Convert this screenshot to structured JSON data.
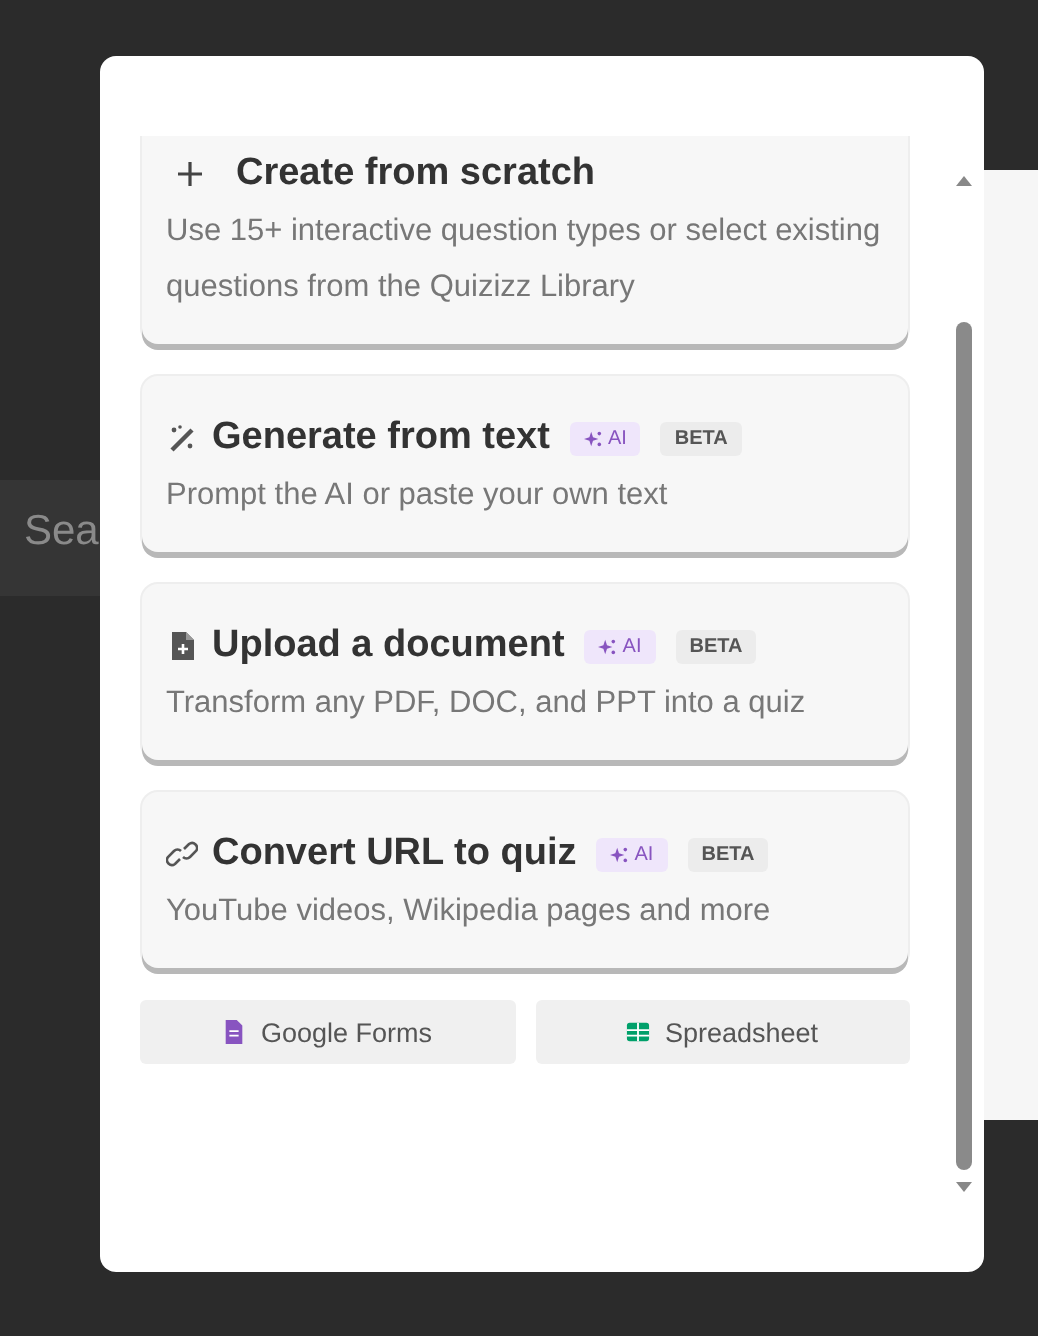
{
  "background_text": "Sea",
  "options": [
    {
      "kind": "scratch",
      "title": "Create from scratch",
      "description": "Use 15+ interactive question types or select existing questions from the Quizizz Library"
    },
    {
      "kind": "text",
      "title": "Generate from text",
      "description": "Prompt the AI or paste your own text",
      "badges": [
        {
          "kind": "ai",
          "label": "AI"
        },
        {
          "kind": "beta",
          "label": "BETA"
        }
      ]
    },
    {
      "kind": "document",
      "title": "Upload a document",
      "description": "Transform any PDF, DOC, and PPT into a quiz",
      "badges": [
        {
          "kind": "ai",
          "label": "AI"
        },
        {
          "kind": "beta",
          "label": "BETA"
        }
      ]
    },
    {
      "kind": "url",
      "title": "Convert URL to quiz",
      "description": "YouTube videos, Wikipedia pages and more",
      "badges": [
        {
          "kind": "ai",
          "label": "AI"
        },
        {
          "kind": "beta",
          "label": "BETA"
        }
      ]
    }
  ],
  "import_buttons": [
    {
      "kind": "forms",
      "label": "Google Forms"
    },
    {
      "kind": "spreadsheet",
      "label": "Spreadsheet"
    }
  ]
}
